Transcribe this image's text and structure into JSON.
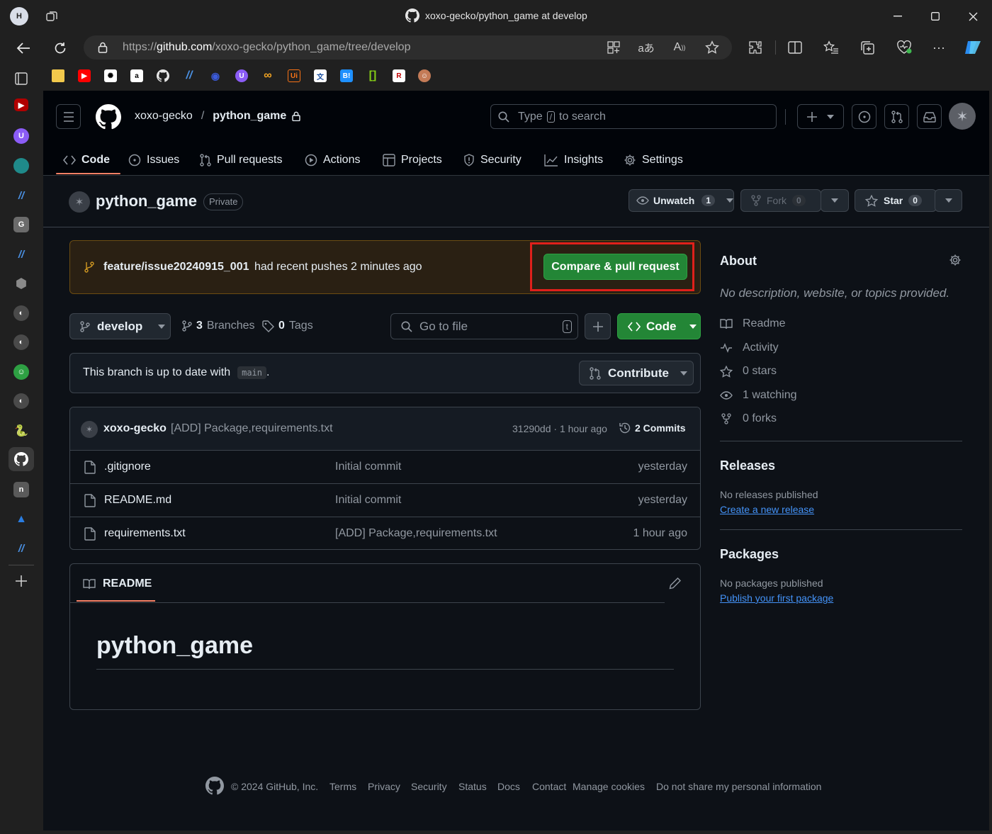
{
  "browser": {
    "profile_initial": "H",
    "window_title": "xoxo-gecko/python_game at develop",
    "url_prefix": "https://",
    "url_host": "github.com",
    "url_path": "/xoxo-gecko/python_game/tree/develop"
  },
  "bookmarks": [
    "folder",
    "youtube",
    "chatgpt",
    "amazon",
    "github",
    "perplexity",
    "fingerprint",
    "proton",
    "infinity",
    "ui",
    "translate",
    "hatena",
    "bracket",
    "rakuten",
    "avatar"
  ],
  "header": {
    "owner": "xoxo-gecko",
    "slash": "/",
    "repo": "python_game",
    "search_pre": "Type",
    "search_key": "/",
    "search_post": "to search"
  },
  "tabs": [
    "Code",
    "Issues",
    "Pull requests",
    "Actions",
    "Projects",
    "Security",
    "Insights",
    "Settings"
  ],
  "repo": {
    "name": "python_game",
    "visibility": "Private",
    "unwatch_label": "Unwatch",
    "watch_count": "1",
    "fork_label": "Fork",
    "fork_count": "0",
    "star_label": "Star",
    "star_count": "0"
  },
  "push_banner": {
    "branch": "feature/issue20240915_001",
    "text": "had recent pushes 2 minutes ago",
    "button": "Compare & pull request"
  },
  "branchbar": {
    "branch": "develop",
    "branches_count": "3",
    "branches_label": "Branches",
    "tags_count": "0",
    "tags_label": "Tags",
    "goto_placeholder": "Go to file",
    "goto_key": "t",
    "code_label": "Code"
  },
  "uptodate": {
    "text": "This branch is up to date with",
    "base": "main",
    "period": ".",
    "contribute": "Contribute"
  },
  "commit": {
    "author": "xoxo-gecko",
    "message": "[ADD] Package,requirements.txt",
    "sha_time": "31290dd · 1 hour ago",
    "commits_label": "2 Commits"
  },
  "files": [
    {
      "name": ".gitignore",
      "message": "Initial commit",
      "time": "yesterday"
    },
    {
      "name": "README.md",
      "message": "Initial commit",
      "time": "yesterday"
    },
    {
      "name": "requirements.txt",
      "message": "[ADD] Package,requirements.txt",
      "time": "1 hour ago"
    }
  ],
  "readme": {
    "tab_label": "README",
    "heading": "python_game"
  },
  "about": {
    "title": "About",
    "description": "No description, website, or topics provided.",
    "items": [
      {
        "icon": "book-icon",
        "label": "Readme"
      },
      {
        "icon": "pulse-icon",
        "label": "Activity"
      },
      {
        "icon": "star-icon",
        "label": "0 stars"
      },
      {
        "icon": "eye-icon",
        "label": "1 watching"
      },
      {
        "icon": "fork-icon",
        "label": "0 forks"
      }
    ]
  },
  "releases": {
    "title": "Releases",
    "empty": "No releases published",
    "link": "Create a new release"
  },
  "packages": {
    "title": "Packages",
    "empty": "No packages published",
    "link": "Publish your first package"
  },
  "footer": {
    "copyright": "© 2024 GitHub, Inc.",
    "links": [
      "Terms",
      "Privacy",
      "Security",
      "Status",
      "Docs",
      "Contact",
      "Manage cookies",
      "Do not share my personal information"
    ]
  },
  "colors": {
    "accent_green": "#238636",
    "link_blue": "#4493f8",
    "highlight_red": "#e0201b",
    "tab_underline": "#f78166"
  }
}
